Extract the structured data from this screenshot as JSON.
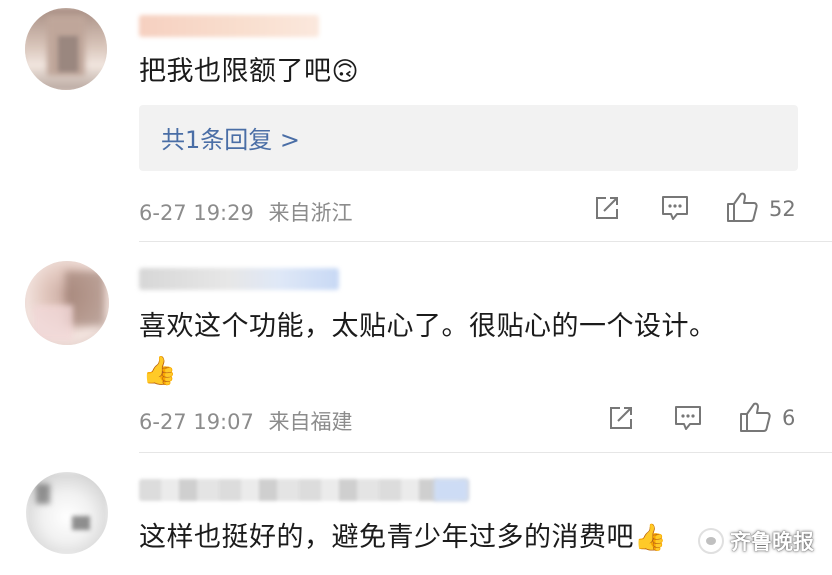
{
  "comments": [
    {
      "text": "把我也限额了吧",
      "emoji": "🙃",
      "replies_label": "共1条回复 >",
      "time": "6-27 19:29",
      "source": "来自浙江",
      "likes": "52"
    },
    {
      "text": "喜欢这个功能，太贴心了。很贴心的一个设计。",
      "emoji": "👍",
      "time": "6-27 19:07",
      "source": "来自福建",
      "likes": "6"
    },
    {
      "text": "这样也挺好的，避免青少年过多的消费吧",
      "emoji": "👍"
    }
  ],
  "watermark": {
    "text": "齐鲁晚报"
  },
  "icons": [
    "share-icon",
    "comment-icon",
    "like-icon"
  ],
  "colors": {
    "link": "#4a6ea6",
    "meta": "#8c8c8c",
    "reply_bg": "#f2f2f2"
  }
}
